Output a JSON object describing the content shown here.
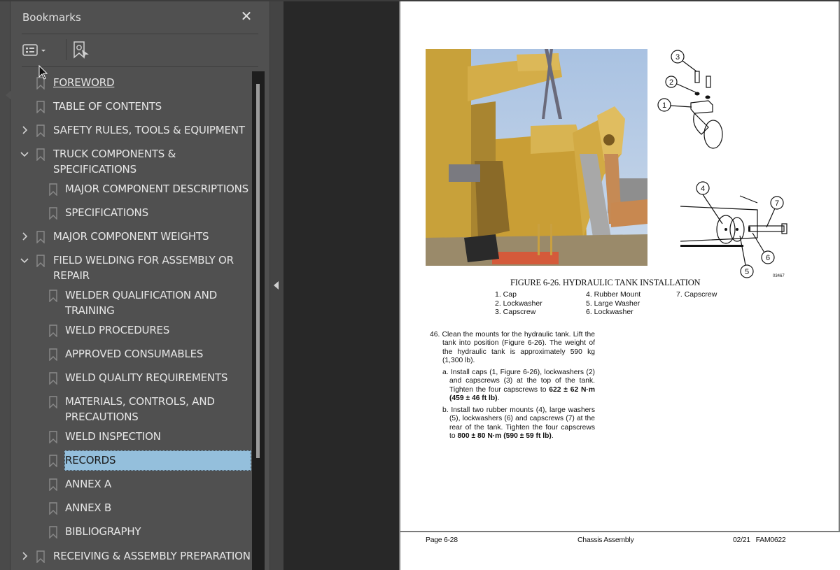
{
  "app": {
    "panel_title": "Bookmarks",
    "close_label": "✕",
    "toolbar": {
      "options_icon": "list-options-icon",
      "find_bookmark_icon": "find-current-bookmark-icon"
    },
    "collapse_panel_icon": "triangle-left-icon"
  },
  "bookmarks": [
    {
      "label": "FOREWORD",
      "level": 0,
      "expander": "none",
      "underline": true
    },
    {
      "label": "TABLE OF CONTENTS",
      "level": 0,
      "expander": "none"
    },
    {
      "label": "SAFETY RULES, TOOLS & EQUIPMENT",
      "level": 0,
      "expander": "collapsed"
    },
    {
      "label": "TRUCK COMPONENTS &",
      "label2": "SPECIFICATIONS",
      "level": 0,
      "expander": "expanded"
    },
    {
      "label": "MAJOR COMPONENT DESCRIPTIONS",
      "level": 1,
      "expander": "none"
    },
    {
      "label": "SPECIFICATIONS",
      "level": 1,
      "expander": "none"
    },
    {
      "label": "MAJOR COMPONENT WEIGHTS",
      "level": 0,
      "expander": "collapsed"
    },
    {
      "label": "FIELD WELDING FOR ASSEMBLY OR",
      "label2": "REPAIR",
      "level": 0,
      "expander": "expanded"
    },
    {
      "label": "WELDER QUALIFICATION AND",
      "label2": "TRAINING",
      "level": 1,
      "expander": "none"
    },
    {
      "label": "WELD PROCEDURES",
      "level": 1,
      "expander": "none"
    },
    {
      "label": "APPROVED CONSUMABLES",
      "level": 1,
      "expander": "none"
    },
    {
      "label": "WELD QUALITY REQUIREMENTS",
      "level": 1,
      "expander": "none"
    },
    {
      "label": "MATERIALS, CONTROLS, AND",
      "label2": "PRECAUTIONS",
      "level": 1,
      "expander": "none"
    },
    {
      "label": "WELD INSPECTION",
      "level": 1,
      "expander": "none"
    },
    {
      "label": "RECORDS",
      "level": 1,
      "expander": "none",
      "selected": true
    },
    {
      "label": "ANNEX A",
      "level": 1,
      "expander": "none"
    },
    {
      "label": "ANNEX B",
      "level": 1,
      "expander": "none"
    },
    {
      "label": "BIBLIOGRAPHY",
      "level": 1,
      "expander": "none"
    },
    {
      "label": "RECEIVING & ASSEMBLY PREPARATION",
      "level": 0,
      "expander": "collapsed"
    }
  ],
  "document": {
    "figure_caption": "FIGURE 6-26. HYDRAULIC TANK INSTALLATION",
    "diagram_callouts": [
      "1",
      "2",
      "3",
      "4",
      "5",
      "6",
      "7"
    ],
    "diagram_id": "03467",
    "legend": {
      "col1": [
        "1. Cap",
        "2. Lockwasher",
        "3. Capscrew"
      ],
      "col2": [
        "4. Rubber Mount",
        "5. Large Washer",
        "6. Lockwasher"
      ],
      "col3": [
        "7. Capscrew"
      ]
    },
    "step46": {
      "number": "46.",
      "text": "Clean the mounts for the hydraulic tank. Lift the tank into position (Figure 6-26). The weight of the hydraulic tank is approximately 590 kg (1,300 lb)."
    },
    "step_a": {
      "marker": "a.",
      "text": "Install caps (1, Figure 6-26), lockwashers (2) and capscrews (3) at the top of the tank. Tighten the four capscrews to ",
      "bold1": "622 ± 62 N·m",
      "bold2": "(459 ± 46 ft lb)",
      "end": "."
    },
    "step_b": {
      "marker": "b.",
      "text": "Install two rubber mounts (4), large washers (5), lockwashers (6) and capscrews (7) at the rear of the tank. Tighten the four capscrews to ",
      "bold1": "800 ± 80 N·m",
      "bold2": "(590 ± 59 ft lb)",
      "end": "."
    },
    "footer": {
      "left": "Page 6-28",
      "center": "Chassis Assembly",
      "right": "02/21   FAM0622"
    }
  },
  "colors": {
    "panel_bg": "#505050",
    "selection": "#94bfdc",
    "viewer_bg": "#282828"
  }
}
